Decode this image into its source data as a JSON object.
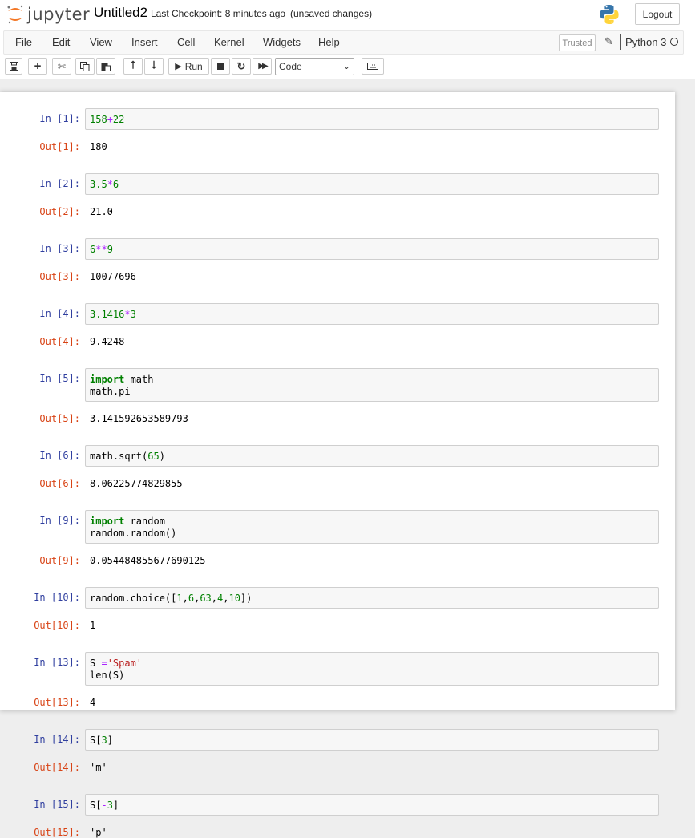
{
  "header": {
    "logo_text": "jupyter",
    "notebook_name": "Untitled2",
    "checkpoint": "Last Checkpoint: 8 minutes ago",
    "save_status": "(unsaved changes)",
    "logout_label": "Logout"
  },
  "menubar": {
    "items": [
      "File",
      "Edit",
      "View",
      "Insert",
      "Cell",
      "Kernel",
      "Widgets",
      "Help"
    ],
    "trusted_label": "Trusted",
    "kernel_name": "Python 3"
  },
  "toolbar": {
    "run_label": "Run",
    "cell_type": "Code"
  },
  "colors": {
    "in_prompt": "#303f9f",
    "out_prompt": "#d84315",
    "keyword": "#008000",
    "number": "#008000",
    "string": "#ba2121",
    "operator": "#aa22ff"
  },
  "cells": [
    {
      "in_prompt": "In [1]:",
      "code": [
        [
          {
            "t": "158",
            "c": "num"
          },
          {
            "t": "+",
            "c": "op"
          },
          {
            "t": "22",
            "c": "num"
          }
        ]
      ],
      "out_prompt": "Out[1]:",
      "output": "180"
    },
    {
      "in_prompt": "In [2]:",
      "code": [
        [
          {
            "t": "3.5",
            "c": "num"
          },
          {
            "t": "*",
            "c": "op"
          },
          {
            "t": "6",
            "c": "num"
          }
        ]
      ],
      "out_prompt": "Out[2]:",
      "output": "21.0"
    },
    {
      "in_prompt": "In [3]:",
      "code": [
        [
          {
            "t": "6",
            "c": "num"
          },
          {
            "t": "**",
            "c": "op"
          },
          {
            "t": "9",
            "c": "num"
          }
        ]
      ],
      "out_prompt": "Out[3]:",
      "output": "10077696"
    },
    {
      "in_prompt": "In [4]:",
      "code": [
        [
          {
            "t": "3.1416",
            "c": "num"
          },
          {
            "t": "*",
            "c": "op"
          },
          {
            "t": "3",
            "c": "num"
          }
        ]
      ],
      "out_prompt": "Out[4]:",
      "output": "9.4248"
    },
    {
      "in_prompt": "In [5]:",
      "code": [
        [
          {
            "t": "import",
            "c": "kw"
          },
          {
            "t": " math",
            "c": ""
          }
        ],
        [
          {
            "t": "math.pi",
            "c": ""
          }
        ]
      ],
      "out_prompt": "Out[5]:",
      "output": "3.141592653589793"
    },
    {
      "in_prompt": "In [6]:",
      "code": [
        [
          {
            "t": "math.sqrt(",
            "c": ""
          },
          {
            "t": "65",
            "c": "num"
          },
          {
            "t": ")",
            "c": ""
          }
        ]
      ],
      "out_prompt": "Out[6]:",
      "output": "8.06225774829855"
    },
    {
      "in_prompt": "In [9]:",
      "code": [
        [
          {
            "t": "import",
            "c": "kw"
          },
          {
            "t": " random",
            "c": ""
          }
        ],
        [
          {
            "t": "random.random()",
            "c": ""
          }
        ]
      ],
      "out_prompt": "Out[9]:",
      "output": "0.054484855677690125"
    },
    {
      "in_prompt": "In [10]:",
      "code": [
        [
          {
            "t": "random.choice([",
            "c": ""
          },
          {
            "t": "1",
            "c": "num"
          },
          {
            "t": ",",
            "c": ""
          },
          {
            "t": "6",
            "c": "num"
          },
          {
            "t": ",",
            "c": ""
          },
          {
            "t": "63",
            "c": "num"
          },
          {
            "t": ",",
            "c": ""
          },
          {
            "t": "4",
            "c": "num"
          },
          {
            "t": ",",
            "c": ""
          },
          {
            "t": "10",
            "c": "num"
          },
          {
            "t": "])",
            "c": ""
          }
        ]
      ],
      "out_prompt": "Out[10]:",
      "output": "1"
    },
    {
      "in_prompt": "In [13]:",
      "code": [
        [
          {
            "t": "S ",
            "c": ""
          },
          {
            "t": "=",
            "c": "op"
          },
          {
            "t": "'Spam'",
            "c": "str"
          }
        ],
        [
          {
            "t": "len(S)",
            "c": ""
          }
        ]
      ],
      "out_prompt": "Out[13]:",
      "output": "4"
    },
    {
      "in_prompt": "In [14]:",
      "code": [
        [
          {
            "t": "S[",
            "c": ""
          },
          {
            "t": "3",
            "c": "num"
          },
          {
            "t": "]",
            "c": ""
          }
        ]
      ],
      "out_prompt": "Out[14]:",
      "output": "'m'"
    },
    {
      "in_prompt": "In [15]:",
      "code": [
        [
          {
            "t": "S[",
            "c": ""
          },
          {
            "t": "-",
            "c": "op"
          },
          {
            "t": "3",
            "c": "num"
          },
          {
            "t": "]",
            "c": ""
          }
        ]
      ],
      "out_prompt": "Out[15]:",
      "output": "'p'"
    }
  ]
}
